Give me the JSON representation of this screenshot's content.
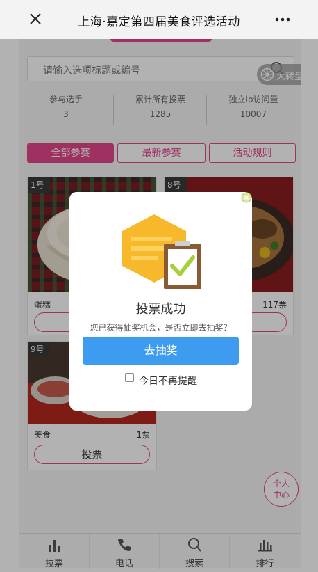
{
  "nav": {
    "title": "上海·嘉定第四届美食评选活动",
    "close_icon": "close-icon",
    "more_icon": "more-dots-icon"
  },
  "search": {
    "placeholder": "请输入选项标题或编号"
  },
  "turntable": {
    "label": "大转盘"
  },
  "stats": [
    {
      "label": "参与选手",
      "value": "3"
    },
    {
      "label": "累计所有投票",
      "value": "1285"
    },
    {
      "label": "独立ip访问量",
      "value": "10007"
    }
  ],
  "tabs": [
    {
      "label": "全部参赛",
      "active": true
    },
    {
      "label": "最新参赛",
      "active": false
    },
    {
      "label": "活动规则",
      "active": false
    }
  ],
  "entries": [
    {
      "num": "1号",
      "name": "蛋糕",
      "votes": "",
      "vote_label": ""
    },
    {
      "num": "8号",
      "name": "",
      "votes": "117票",
      "vote_label": ""
    },
    {
      "num": "9号",
      "name": "美食",
      "votes": "1票",
      "vote_label": "投票"
    }
  ],
  "personal_center": {
    "line1": "个人",
    "line2": "中心"
  },
  "bottom_nav": [
    {
      "label": "拉票",
      "icon": "bar-chart-icon"
    },
    {
      "label": "电话",
      "icon": "phone-icon"
    },
    {
      "label": "搜索",
      "icon": "search-icon"
    },
    {
      "label": "排行",
      "icon": "ranking-icon"
    }
  ],
  "dialog": {
    "title": "投票成功",
    "message": "您已获得抽奖机会，是否立即去抽奖？",
    "button": "去抽奖",
    "checkbox_label": "今日不再提醒",
    "checkbox_checked": false
  },
  "colors": {
    "accent": "#e4478c",
    "button_blue": "#3d9cf0",
    "illustration_yellow": "#f7b92b",
    "check_green": "#a8cf3b"
  }
}
